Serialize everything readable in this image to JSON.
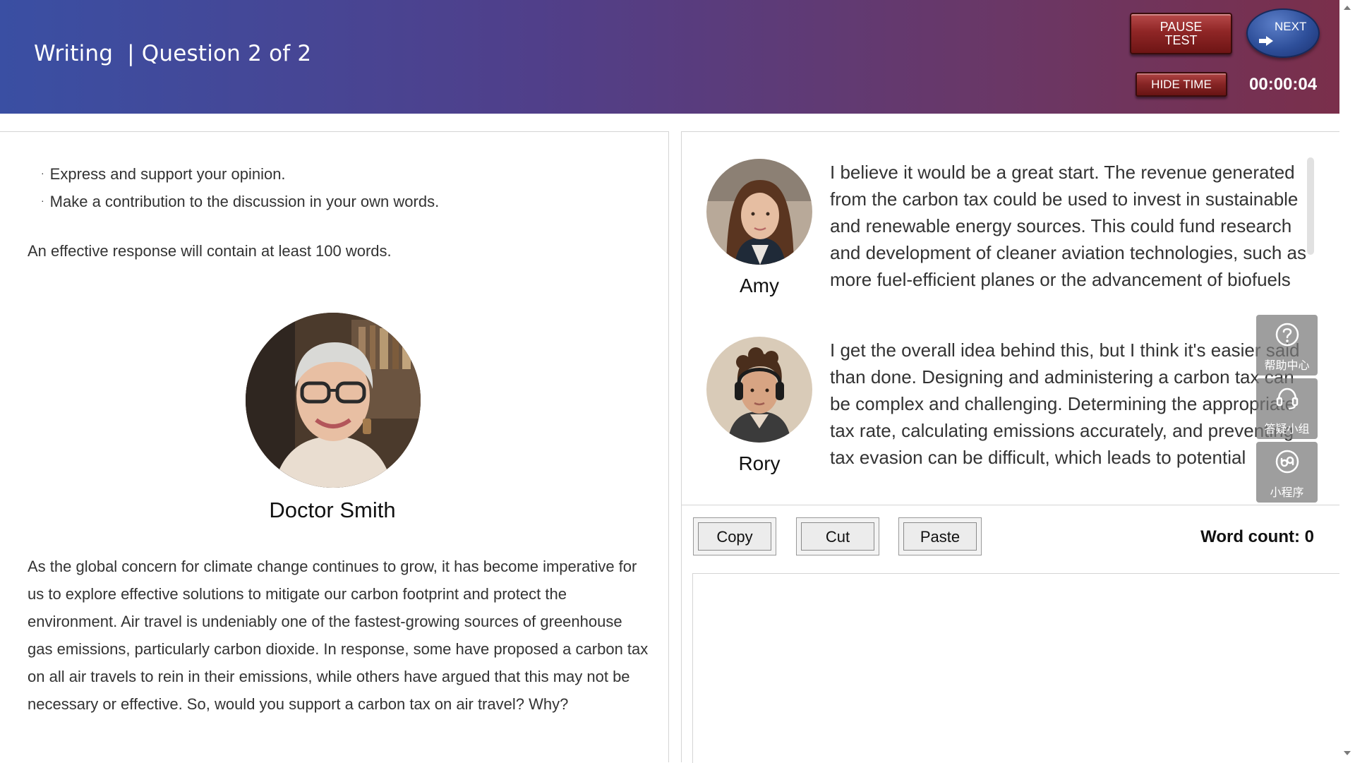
{
  "header": {
    "section": "Writing",
    "separator": "|",
    "question": "Question 2 of 2",
    "pause_label_line1": "PAUSE",
    "pause_label_line2": "TEST",
    "next_label": "NEXT",
    "hide_time_label": "HIDE TIME",
    "timer": "00:00:04",
    "colors": {
      "gradient_start": "#3a4fa3",
      "gradient_end": "#7a2f4b",
      "button_red": "#8f2626",
      "button_blue": "#2e4f9a"
    }
  },
  "instructions": {
    "bullets": [
      "Express and support your opinion.",
      "Make a contribution to the discussion in your own words."
    ],
    "effective_note": "An effective response will contain at least 100 words."
  },
  "professor": {
    "name": "Doctor Smith",
    "text": "As the global concern for climate change continues to grow, it has become imperative for us to explore effective solutions to mitigate our carbon footprint and protect the environment. Air travel is undeniably one of the fastest-growing sources of greenhouse gas emissions, particularly carbon dioxide. In response, some have proposed a carbon tax on all air travels to rein in their emissions, while others have argued that this may not be necessary or effective. So, would you support a carbon tax on air travel? Why?"
  },
  "posts": [
    {
      "name": "Amy",
      "text": "I believe it would be a great start. The revenue generated from the carbon tax could be used to invest in sustainable and renewable energy sources. This could fund research and development of cleaner aviation technologies, such as more fuel-efficient planes or the advancement of biofuels for aircraft, ultimately helping"
    },
    {
      "name": "Rory",
      "text": "I get the overall idea behind this, but I think it's easier said than done. Designing and administering a carbon tax can be complex and challenging. Determining the appropriate tax rate, calculating emissions accurately, and preventing tax evasion can be difficult, which leads to potential inefficiencies and ineffectiveness."
    }
  ],
  "editor": {
    "copy_label": "Copy",
    "cut_label": "Cut",
    "paste_label": "Paste",
    "word_count_label": "Word count:",
    "word_count_value": "0",
    "answer_value": ""
  },
  "side_widgets": [
    {
      "label": "帮助中心",
      "icon": "question-circle-icon"
    },
    {
      "label": "答疑小组",
      "icon": "headset-icon"
    },
    {
      "label": "小程序",
      "icon": "mini-program-icon"
    }
  ]
}
